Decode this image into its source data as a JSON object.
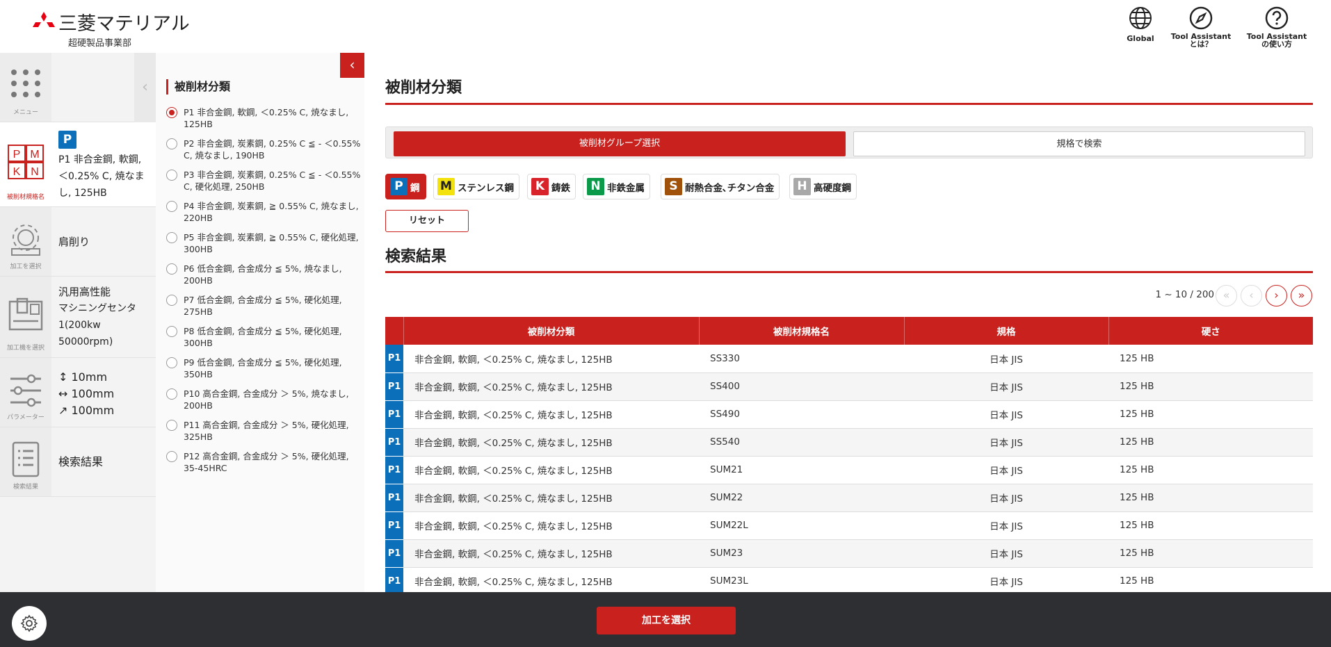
{
  "header": {
    "company": "三菱マテリアル",
    "division": "超硬製品事業部",
    "buttons": {
      "global": "Global",
      "about_line1": "Tool Assistant",
      "about_line2": "とは？",
      "howto_line1": "Tool Assistant",
      "howto_line2": "の使い方"
    },
    "brand_color": "#c8211e"
  },
  "rail": {
    "menu_caption": "メニュー",
    "material": {
      "caption": "被削材規格名",
      "badge": "P",
      "text": "P1 非合金鋼, 軟鋼, ＜0.25% C, 焼なまし, 125HB",
      "icon_letters": [
        "P",
        "M",
        "K",
        "N"
      ]
    },
    "process": {
      "caption": "加工を選択",
      "text": "肩削り"
    },
    "machine": {
      "caption": "加工機を選択",
      "line1": "汎用高性能",
      "line2": "マシニングセンタ",
      "line3": "1(200kw",
      "line4": "50000rpm)"
    },
    "params": {
      "caption": "パラメーター",
      "depth": "↕ 10mm",
      "width": "↔ 100mm",
      "length": "↗ 100mm"
    },
    "results": {
      "caption": "検索結果",
      "text": "検索結果"
    }
  },
  "filter": {
    "title": "被削材分類",
    "options": [
      {
        "text": "P1 非合金鋼, 軟鋼, ＜0.25% C, 焼なまし, 125HB",
        "selected": true
      },
      {
        "text": "P2 非合金鋼, 炭素鋼, 0.25% C ≦ - ＜0.55% C, 焼なまし, 190HB",
        "selected": false
      },
      {
        "text": "P3 非合金鋼, 炭素鋼, 0.25% C ≦ - ＜0.55% C, 硬化処理, 250HB",
        "selected": false
      },
      {
        "text": "P4 非合金鋼, 炭素鋼, ≧ 0.55% C, 焼なまし, 220HB",
        "selected": false
      },
      {
        "text": "P5 非合金鋼, 炭素鋼, ≧ 0.55% C, 硬化処理, 300HB",
        "selected": false
      },
      {
        "text": "P6 低合金鋼, 合金成分 ≦ 5%, 焼なまし, 200HB",
        "selected": false
      },
      {
        "text": "P7 低合金鋼, 合金成分 ≦ 5%, 硬化処理, 275HB",
        "selected": false
      },
      {
        "text": "P8 低合金鋼, 合金成分 ≦ 5%, 硬化処理, 300HB",
        "selected": false
      },
      {
        "text": "P9 低合金鋼, 合金成分 ≦ 5%, 硬化処理, 350HB",
        "selected": false
      },
      {
        "text": "P10 高合金鋼, 合金成分 ＞ 5%, 焼なまし, 200HB",
        "selected": false
      },
      {
        "text": "P11 高合金鋼, 合金成分 ＞ 5%, 硬化処理, 325HB",
        "selected": false
      },
      {
        "text": "P12 高合金鋼, 合金成分 ＞ 5%, 硬化処理, 35-45HRC",
        "selected": false
      }
    ]
  },
  "main": {
    "title": "被削材分類",
    "tabs": {
      "group": "被削材グループ選択",
      "standard": "規格で検索"
    },
    "groups": [
      {
        "letter": "P",
        "label": "鋼",
        "color": "#0b6fba",
        "selected": true
      },
      {
        "letter": "M",
        "label": "ステンレス鋼",
        "color": "#f4e20c",
        "selected": false
      },
      {
        "letter": "K",
        "label": "鋳鉄",
        "color": "#d8232a",
        "selected": false
      },
      {
        "letter": "N",
        "label": "非鉄金属",
        "color": "#0a9a4a",
        "selected": false
      },
      {
        "letter": "S",
        "label": "耐熱合金､チタン合金",
        "color": "#a0520b",
        "selected": false
      },
      {
        "letter": "H",
        "label": "高硬度鋼",
        "color": "#a8a8a8",
        "selected": false
      }
    ],
    "reset": "リセット",
    "results_title": "検索結果",
    "pager": "1 ~ 10 / 200",
    "table": {
      "headers": [
        "被削材分類",
        "被削材規格名",
        "規格",
        "硬さ"
      ],
      "rows": [
        {
          "code": "P1",
          "category": "非合金鋼, 軟鋼, ＜0.25% C, 焼なまし, 125HB",
          "name": "SS330",
          "standard": "日本 JIS",
          "hardness": "125 HB"
        },
        {
          "code": "P1",
          "category": "非合金鋼, 軟鋼, ＜0.25% C, 焼なまし, 125HB",
          "name": "SS400",
          "standard": "日本 JIS",
          "hardness": "125 HB"
        },
        {
          "code": "P1",
          "category": "非合金鋼, 軟鋼, ＜0.25% C, 焼なまし, 125HB",
          "name": "SS490",
          "standard": "日本 JIS",
          "hardness": "125 HB"
        },
        {
          "code": "P1",
          "category": "非合金鋼, 軟鋼, ＜0.25% C, 焼なまし, 125HB",
          "name": "SS540",
          "standard": "日本 JIS",
          "hardness": "125 HB"
        },
        {
          "code": "P1",
          "category": "非合金鋼, 軟鋼, ＜0.25% C, 焼なまし, 125HB",
          "name": "SUM21",
          "standard": "日本 JIS",
          "hardness": "125 HB"
        },
        {
          "code": "P1",
          "category": "非合金鋼, 軟鋼, ＜0.25% C, 焼なまし, 125HB",
          "name": "SUM22",
          "standard": "日本 JIS",
          "hardness": "125 HB"
        },
        {
          "code": "P1",
          "category": "非合金鋼, 軟鋼, ＜0.25% C, 焼なまし, 125HB",
          "name": "SUM22L",
          "standard": "日本 JIS",
          "hardness": "125 HB"
        },
        {
          "code": "P1",
          "category": "非合金鋼, 軟鋼, ＜0.25% C, 焼なまし, 125HB",
          "name": "SUM23",
          "standard": "日本 JIS",
          "hardness": "125 HB"
        },
        {
          "code": "P1",
          "category": "非合金鋼, 軟鋼, ＜0.25% C, 焼なまし, 125HB",
          "name": "SUM23L",
          "standard": "日本 JIS",
          "hardness": "125 HB"
        }
      ]
    }
  },
  "footer": {
    "primary": "加工を選択"
  }
}
